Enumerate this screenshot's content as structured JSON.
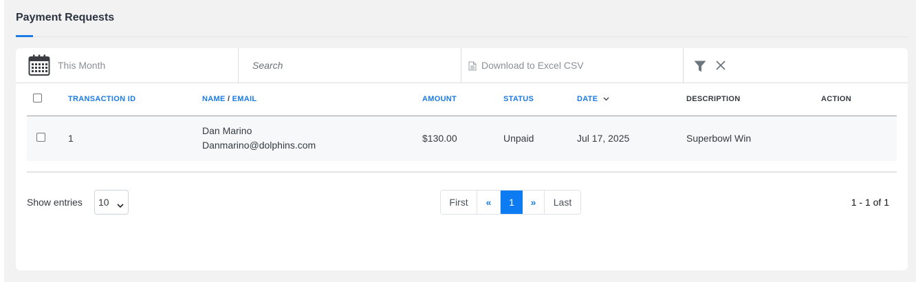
{
  "page": {
    "title": "Payment Requests"
  },
  "toolbar": {
    "date_range": "This Month",
    "search_placeholder": "Search",
    "download_label": "Download to Excel CSV"
  },
  "table": {
    "headers": {
      "transaction_id": "TRANSACTION ID",
      "name": "NAME",
      "separator": " / ",
      "email": "EMAIL",
      "amount": "AMOUNT",
      "status": "STATUS",
      "date": "DATE",
      "description": "DESCRIPTION",
      "action": "ACTION"
    },
    "rows": [
      {
        "transaction_id": "1",
        "name": "Dan Marino",
        "email": "Danmarino@dolphins.com",
        "amount": "$130.00",
        "status": "Unpaid",
        "date": "Jul 17, 2025",
        "description": "Superbowl Win",
        "action": ""
      }
    ]
  },
  "footer": {
    "show_entries_label": "Show entries",
    "entries_value": "10",
    "pagination": {
      "first": "First",
      "prev": "«",
      "current": "1",
      "next": "»",
      "last": "Last"
    },
    "range_text": "1 - 1 of 1"
  },
  "colors": {
    "accent": "#1a7be6",
    "active_page": "#0d7bf2"
  }
}
